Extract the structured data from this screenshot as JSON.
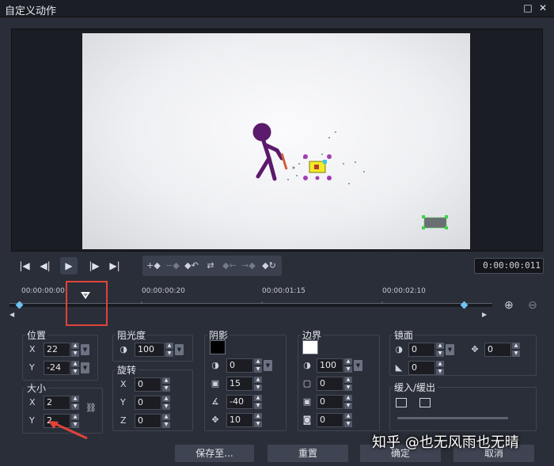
{
  "window": {
    "title": "自定义动作",
    "buttons": {
      "maximize": "□",
      "close": "✕"
    }
  },
  "transport": {
    "timecode": "0:00:00:011",
    "buttons": [
      "go-to-start",
      "previous-frame",
      "play",
      "next-frame",
      "go-to-end"
    ],
    "edit_buttons": [
      "add-keyframe",
      "remove-keyframe",
      "reverse-keyframes",
      "swap",
      "move-left",
      "move-right",
      "copy-keyframe"
    ]
  },
  "timeline": {
    "labels": [
      "00:00:00:00",
      "00:00:00:20",
      "00:00:01:15",
      "00:00:02:10"
    ],
    "keyframes_count": 2
  },
  "position": {
    "label": "位置",
    "x": "22",
    "y": "-24"
  },
  "size": {
    "label": "大小",
    "x": "2",
    "y": "2"
  },
  "opacity": {
    "label": "阻光度",
    "value": "100"
  },
  "rotation": {
    "label": "旋转",
    "x": "0",
    "y": "0",
    "z": "0"
  },
  "shadow": {
    "label": "阴影",
    "color": "#000000",
    "values": [
      "0",
      "15",
      "-40",
      "10"
    ]
  },
  "border": {
    "label": "边界",
    "color": "#ffffff",
    "values": [
      "100",
      "0",
      "0",
      "0"
    ]
  },
  "mirror": {
    "label": "镜面",
    "values": [
      "0",
      "0",
      "0"
    ]
  },
  "ease": {
    "label": "缓入/缓出"
  },
  "axes": {
    "x": "X",
    "y": "Y",
    "z": "Z"
  },
  "footer": {
    "save_to": "保存至...",
    "reset": "重置",
    "ok": "确定",
    "cancel": "取消"
  },
  "watermark": "知乎 @也无风雨也无晴",
  "colors": {
    "accent_red": "#e0433a",
    "figure": "#5b1a6b",
    "keyframe": "#6ec3f0"
  }
}
